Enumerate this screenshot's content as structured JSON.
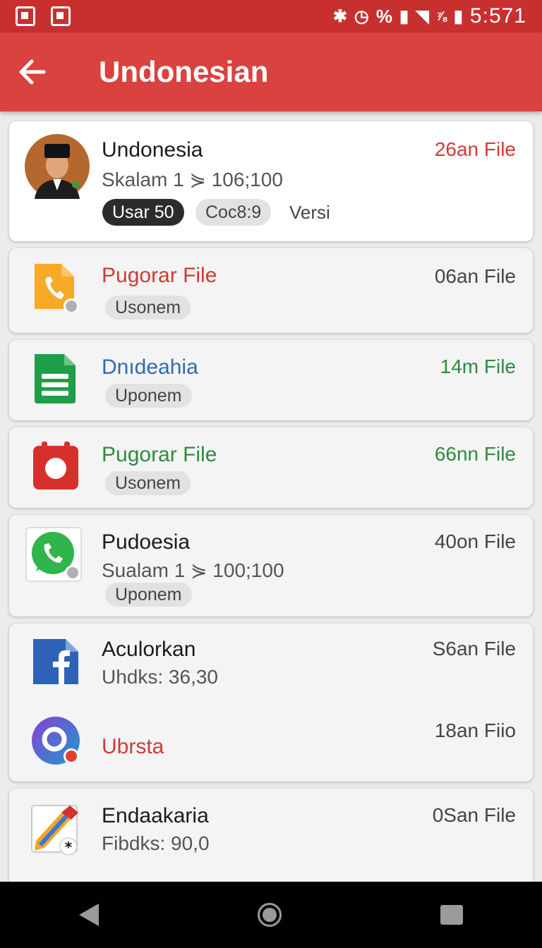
{
  "status_bar": {
    "percent": "%",
    "signal_text": "⅞",
    "time": "5:571"
  },
  "app_bar": {
    "title": "Undonesian"
  },
  "profile": {
    "name": "Undonesia",
    "detail": "Skalam 1 ⋟ 106;100",
    "size": "26an File",
    "chip_user": "Usar 50",
    "chip_code": "Coc8:9",
    "version": "Versi"
  },
  "items": [
    {
      "title": "Pugorar File",
      "size": "06an File",
      "chip": "Usonem"
    },
    {
      "title": "Dnıdeahia",
      "size": "14m File",
      "chip": "Uponem"
    },
    {
      "title": "Pugorar File",
      "size": "66nn File",
      "chip": "Usonem"
    },
    {
      "title": "Pudoesia",
      "subtitle": "Sualam 1 ⋟ 100;100",
      "size": "40on File",
      "chip": "Uponem"
    },
    {
      "title": "Aculorkan",
      "subtitle": "Uhdks: 36,30",
      "size": "S6an File"
    },
    {
      "title": "Ubrsta",
      "size": "18an Fiio"
    },
    {
      "title": "Endaakaria",
      "subtitle": "Fibdks: 90,0",
      "size": "0San File"
    }
  ],
  "colors": {
    "accent": "#d9423f",
    "status": "#c8302f",
    "red_text": "#d03a34",
    "blue_text": "#2f6bb2",
    "green_text": "#2f8a3e"
  }
}
